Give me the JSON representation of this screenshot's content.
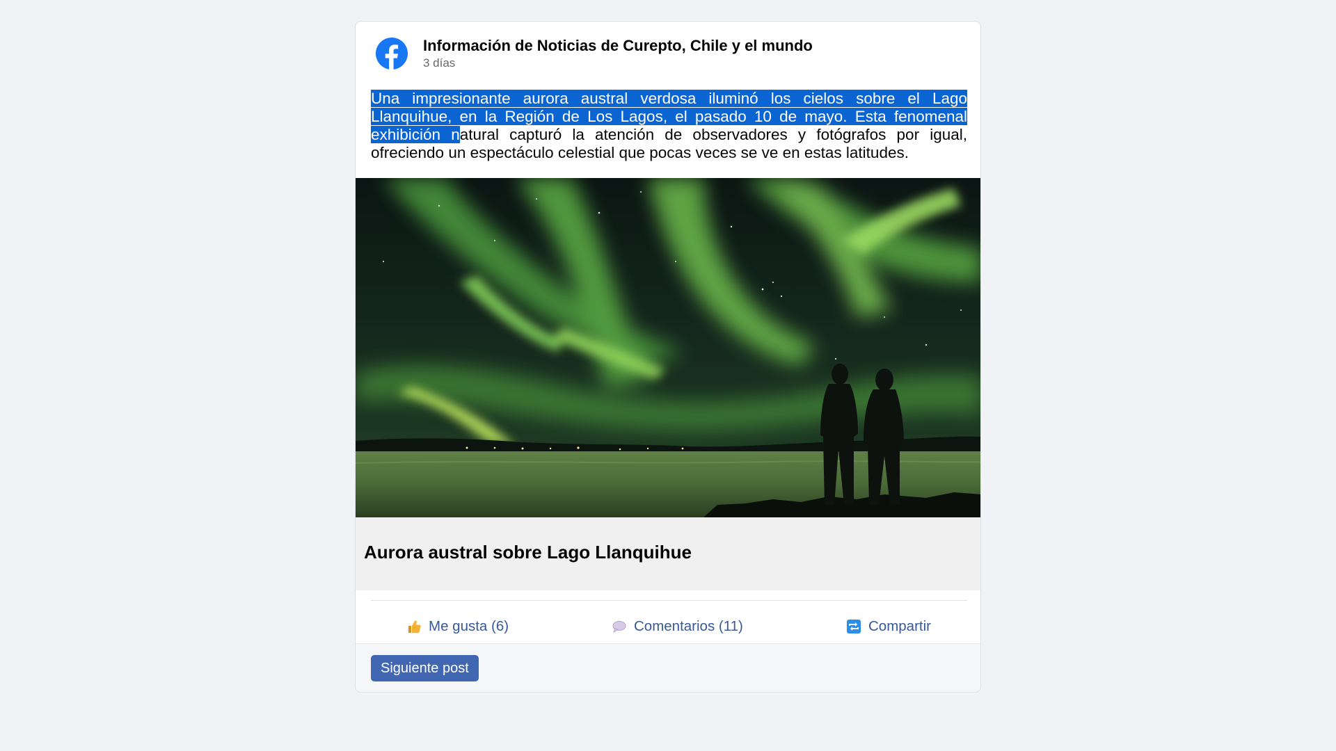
{
  "post": {
    "page_name": "Información de Noticias de Curepto, Chile y el mundo",
    "time": "3 días",
    "text_selected": "Una impresionante aurora austral verdosa iluminó los cielos sobre el Lago Llanquihue, en la Región de Los Lagos, el pasado 10 de mayo. Esta fenomenal exhibición n",
    "text_rest": "atural capturó la atención de observadores y fotógrafos por igual, ofreciendo un espectáculo celestial que pocas veces se ve en estas latitudes.",
    "image": {
      "icon": "aurora-photo",
      "sky_colors": [
        "#0c1614",
        "#1d3a22",
        "#63b548",
        "#aedd5e"
      ],
      "lake_color": "#4e6e3c"
    },
    "link_title": "Aurora austral sobre Lago Llanquihue"
  },
  "actions": {
    "like_label": "Me gusta (6)",
    "comment_label": "Comentarios (11)",
    "share_label": "Compartir"
  },
  "footer": {
    "next_label": "Siguiente post"
  },
  "colors": {
    "brand_blue": "#1877f2",
    "action_link": "#385898",
    "button_blue": "#4267b2",
    "selection": "#0a64d2"
  },
  "icons": {
    "logo": "facebook-logo-icon",
    "like": "thumbs-up-icon",
    "comment": "speech-bubble-icon",
    "share": "share-arrows-icon"
  }
}
